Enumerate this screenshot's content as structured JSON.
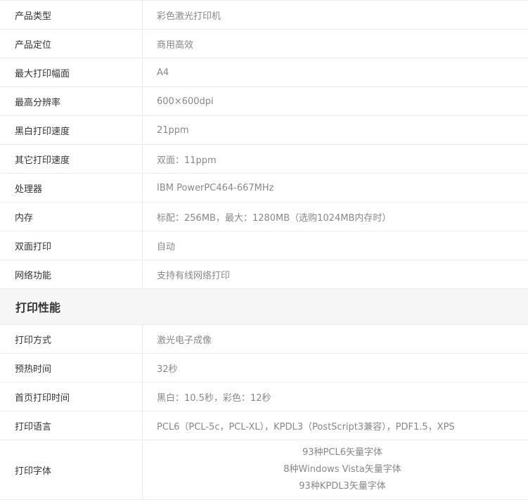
{
  "basic_specs": [
    {
      "label": "产品类型",
      "value": "彩色激光打印机"
    },
    {
      "label": "产品定位",
      "value": "商用高效"
    },
    {
      "label": "最大打印幅面",
      "value": "A4"
    },
    {
      "label": "最高分辨率",
      "value": "600×600dpi"
    },
    {
      "label": "黑白打印速度",
      "value": "21ppm"
    },
    {
      "label": "其它打印速度",
      "value": "双面：11ppm"
    },
    {
      "label": "处理器",
      "value": "IBM PowerPC464-667MHz"
    },
    {
      "label": "内存",
      "value": "标配：256MB，最大：1280MB（选购1024MB内存时）"
    },
    {
      "label": "双面打印",
      "value": "自动"
    },
    {
      "label": "网络功能",
      "value": "支持有线网络打印"
    }
  ],
  "section_title": "打印性能",
  "print_specs": [
    {
      "label": "打印方式",
      "value": "激光电子成像"
    },
    {
      "label": "预热时间",
      "value": "32秒"
    },
    {
      "label": "首页打印时间",
      "value": "黑白：10.5秒，彩色：12秒"
    },
    {
      "label": "打印语言",
      "value": "PCL6（PCL-5c，PCL-XL），KPDL3（PostScript3兼容），PDF1.5，XPS"
    }
  ],
  "font_spec": {
    "label": "打印字体",
    "lines": [
      "93种PCL6矢量字体",
      "8种Windows Vista矢量字体",
      "93种KPDL3矢量字体"
    ]
  }
}
